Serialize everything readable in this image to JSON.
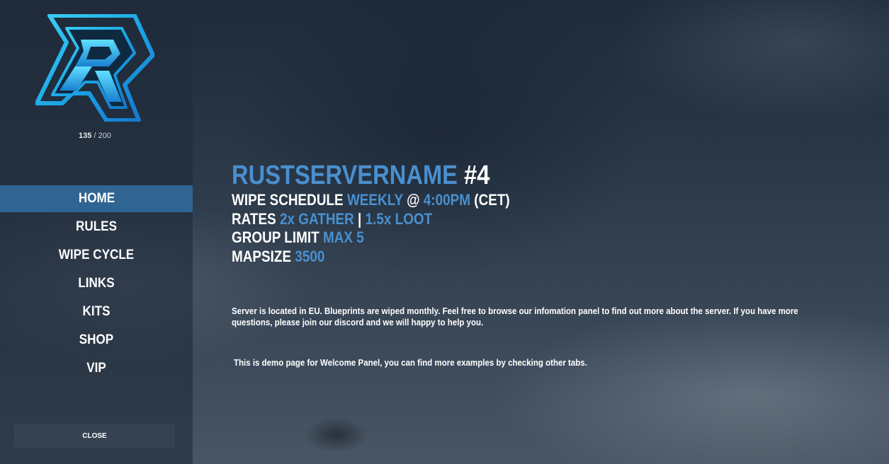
{
  "sidebar": {
    "logo_icon": "r-logo-icon",
    "player_count": {
      "current": "135",
      "separator": " / ",
      "max": "200"
    },
    "nav_items": [
      {
        "label": "HOME",
        "active": true
      },
      {
        "label": "RULES",
        "active": false
      },
      {
        "label": "WIPE CYCLE",
        "active": false
      },
      {
        "label": "LINKS",
        "active": false
      },
      {
        "label": "KITS",
        "active": false
      },
      {
        "label": "SHOP",
        "active": false
      },
      {
        "label": "VIP",
        "active": false
      }
    ],
    "close_label": "CLOSE"
  },
  "main": {
    "title_name": "RUSTSERVERNAME",
    "title_number": " #4",
    "wipe": {
      "label": "WIPE SCHEDULE ",
      "frequency": "WEEKLY",
      "at": " @ ",
      "time": "4:00PM",
      "tz": " (CET)"
    },
    "rates": {
      "label": "RATES ",
      "gather": "2x GATHER",
      "sep": " | ",
      "loot": "1.5x LOOT"
    },
    "group_limit": {
      "label": "GROUP LIMIT ",
      "value": "MAX 5"
    },
    "mapsize": {
      "label": "MAPSIZE ",
      "value": "3500"
    },
    "description": "Server is located in EU. Blueprints are wiped monthly. Feel free to browse our infomation panel to find out more about the server. If you have more questions, please join our discord and we will happy to help you.",
    "demo_note": "This is demo page for Welcome Panel, you can find more examples by checking other tabs."
  },
  "colors": {
    "accent": "#4a8fce",
    "active_tab": "#2f6493",
    "sidebar_bg": "#202c3a",
    "text": "#ffffff"
  }
}
